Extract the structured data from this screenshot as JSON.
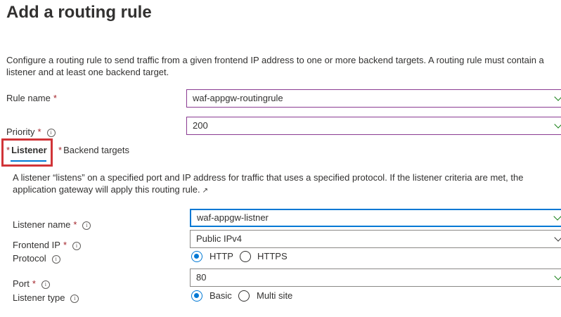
{
  "page": {
    "title": "Add a routing rule",
    "description": "Configure a routing rule to send traffic from a given frontend IP address to one or more backend targets. A routing rule must contain a listener and at least one backend target."
  },
  "rule": {
    "name_label": "Rule name",
    "name_value": "waf-appgw-routingrule",
    "priority_label": "Priority",
    "priority_value": "200",
    "required_marker": "*",
    "info_glyph": "i"
  },
  "tabs": [
    {
      "label": "Listener",
      "active": true
    },
    {
      "label": "Backend targets",
      "active": false
    }
  ],
  "listener": {
    "description": "A listener “listens” on a specified port and IP address for traffic that uses a specified protocol. If the listener criteria are met, the application gateway will apply this routing rule.",
    "name_label": "Listener name",
    "name_value": "waf-appgw-listner",
    "frontend_ip_label": "Frontend IP",
    "frontend_ip_value": "Public IPv4",
    "protocol_label": "Protocol",
    "protocol_options": [
      "HTTP",
      "HTTPS"
    ],
    "protocol_selected": "HTTP",
    "port_label": "Port",
    "port_value": "80",
    "listener_type_label": "Listener type",
    "listener_type_options": [
      "Basic",
      "Multi site"
    ],
    "listener_type_selected": "Basic"
  },
  "icons": {
    "info": "info-circle-icon",
    "chevron": "chevron-down-icon",
    "external": "external-link-icon"
  },
  "colors": {
    "accent": "#0078d4",
    "required": "#a4262c",
    "highlight": "#d13438",
    "valid": "#107c10"
  }
}
